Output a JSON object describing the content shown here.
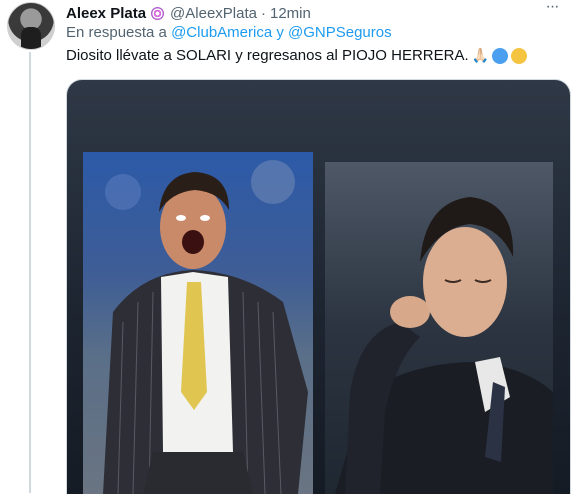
{
  "tweet": {
    "display_name": "Aleex Plata",
    "handle": "@AleexPlata",
    "separator": "·",
    "time": "12min",
    "more_label": "···",
    "reply_prefix": "En respuesta a",
    "reply_to_1": "@ClubAmerica",
    "reply_and": "y",
    "reply_to_2": "@GNPSeguros",
    "text": "Diosito llévate a SOLARI y regresanos al PIOJO HERRERA.",
    "emojis": [
      "folded-hands-emoji",
      "blue-circle-emoji",
      "yellow-circle-emoji"
    ],
    "emoji_pray": "🙏🏻",
    "colors": {
      "link": "#1d9bf0",
      "muted": "#536471",
      "blue_circle": "#4aa0ef",
      "yellow_circle": "#f5c542"
    }
  }
}
